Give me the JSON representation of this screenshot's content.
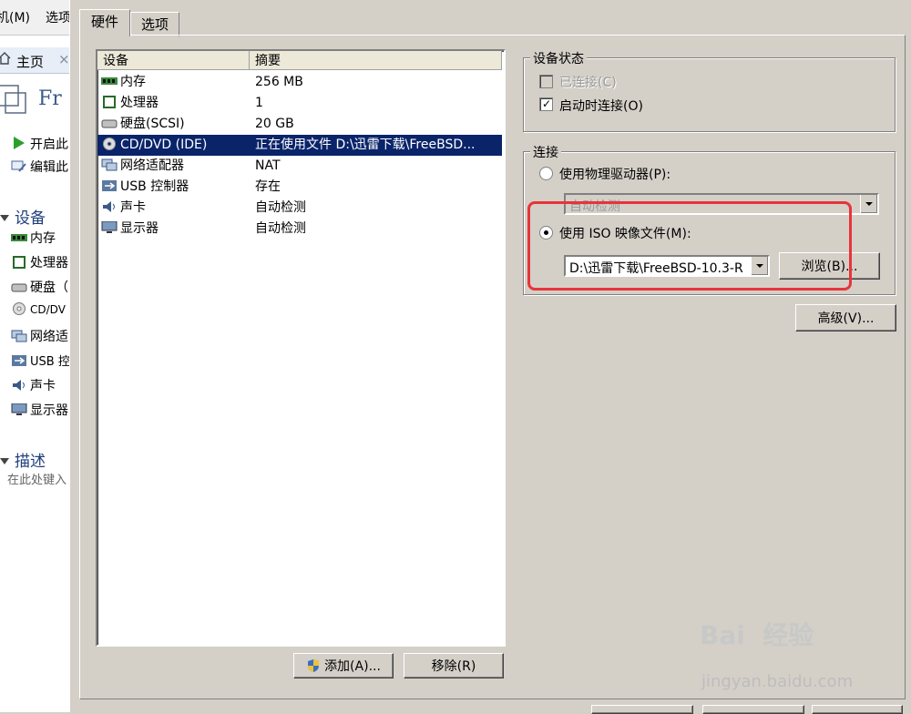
{
  "left_panel": {
    "menu_items": [
      "机(M)",
      "选项"
    ],
    "tab_home": "主页",
    "tab_close": "×",
    "vm_title": "Fr",
    "actions": [
      "开启此",
      "编辑此"
    ],
    "devices_header": "设备",
    "devices": [
      "内存",
      "处理器",
      "硬盘（",
      "CD/DV",
      "网络适",
      "USB 控",
      "声卡",
      "显示器"
    ],
    "desc_header": "描述",
    "desc_placeholder": "在此处键入"
  },
  "tabs": [
    "硬件",
    "选项"
  ],
  "hardware_list": {
    "columns": [
      "设备",
      "摘要"
    ],
    "rows": [
      {
        "device": "内存",
        "summary": "256 MB",
        "icon": "memory-icon"
      },
      {
        "device": "处理器",
        "summary": "1",
        "icon": "processor-icon"
      },
      {
        "device": "硬盘(SCSI)",
        "summary": "20 GB",
        "icon": "harddisk-icon"
      },
      {
        "device": "CD/DVD (IDE)",
        "summary": "正在使用文件 D:\\迅雷下载\\FreeBSD...",
        "icon": "cd-icon",
        "selected": true
      },
      {
        "device": "网络适配器",
        "summary": "NAT",
        "icon": "network-icon"
      },
      {
        "device": "USB 控制器",
        "summary": "存在",
        "icon": "usb-icon"
      },
      {
        "device": "声卡",
        "summary": "自动检测",
        "icon": "sound-icon"
      },
      {
        "device": "显示器",
        "summary": "自动检测",
        "icon": "display-icon"
      }
    ]
  },
  "buttons": {
    "add": "添加(A)...",
    "remove": "移除(R)",
    "browse": "浏览(B)...",
    "advanced": "高级(V)..."
  },
  "device_status": {
    "title": "设备状态",
    "connected_label": "已连接(C)",
    "connected_checked": false,
    "connect_at_poweron_label": "启动时连接(O)",
    "connect_at_poweron_checked": true
  },
  "connection": {
    "title": "连接",
    "physical_label": "使用物理驱动器(P):",
    "physical_value": "自动检测",
    "iso_label": "使用 ISO 映像文件(M):",
    "iso_value": "D:\\迅雷下载\\FreeBSD-10.3-R",
    "selected": "iso"
  },
  "watermark": {
    "main": "Bai  经验",
    "url": "jingyan.baidu.com"
  },
  "colors": {
    "selection": "#0a246a",
    "highlight": "#e8343a",
    "dialog_bg": "#d4d0c8"
  }
}
